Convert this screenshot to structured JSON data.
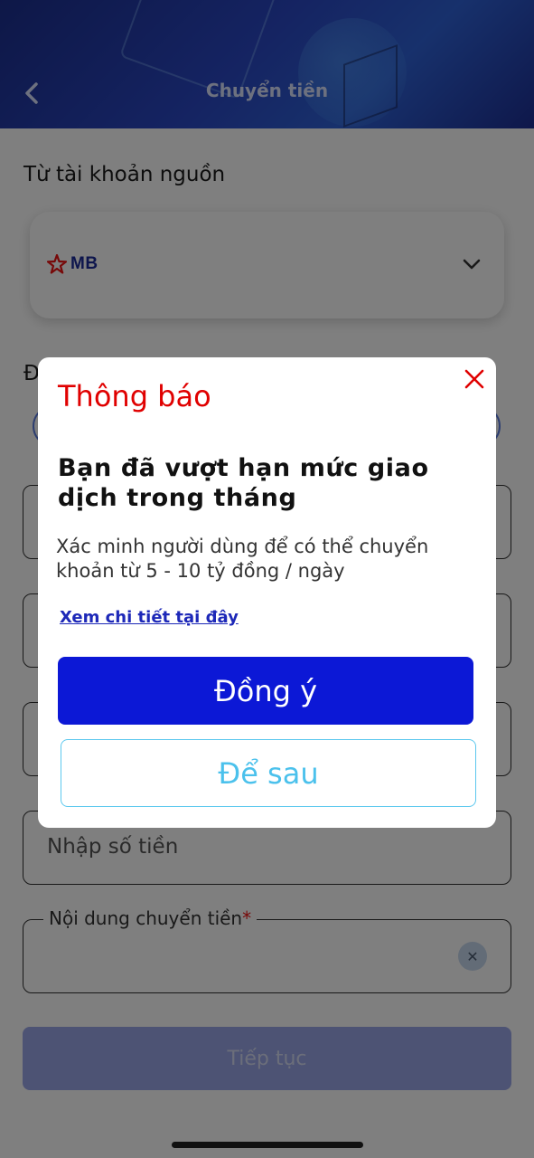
{
  "header": {
    "title": "Chuyển tiền"
  },
  "source_account": {
    "label": "Từ tài khoản nguồn",
    "bank_logo_text": "MB"
  },
  "destination": {
    "label_partial": "Đ"
  },
  "fields": {
    "amount_placeholder": "Nhập số tiền",
    "content_label": "Nội dung chuyển tiền",
    "required_mark": "*",
    "clear_glyph": "✕"
  },
  "continue_label": "Tiếp tục",
  "dialog": {
    "title": "Thông báo",
    "heading": "Bạn đã vượt hạn mức giao dịch trong tháng",
    "body": "Xác minh người dùng để có thể chuyển khoản từ 5 - 10 tỷ đồng / ngày",
    "link": "Xem chi tiết tại đây",
    "confirm": "Đồng ý",
    "later": "Để sau"
  },
  "colors": {
    "accent_red": "#e00000",
    "primary_blue": "#0c18d6",
    "secondary_cyan": "#4bc1ec"
  },
  "icons": [
    "back-arrow-icon",
    "chevron-down-icon",
    "close-icon",
    "mb-bank-star-icon"
  ]
}
